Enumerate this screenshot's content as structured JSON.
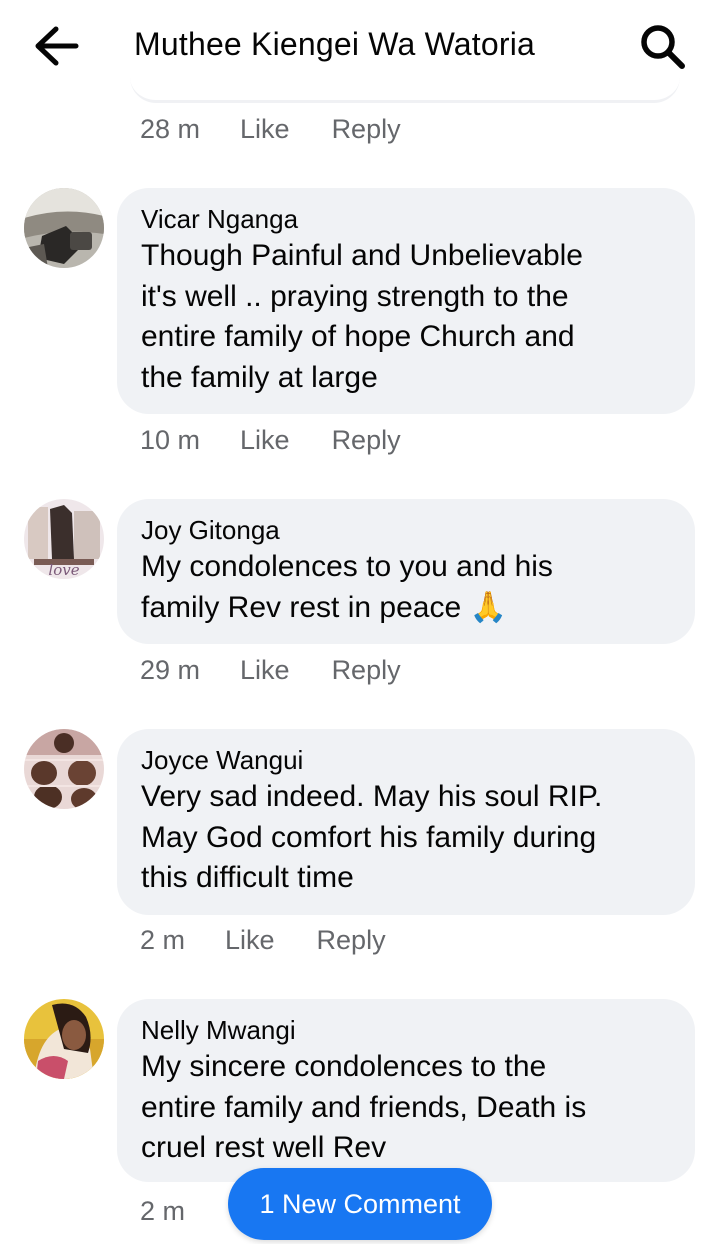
{
  "header": {
    "title": "Muthee Kiengei Wa Watoria",
    "back_icon": "arrow-left-icon",
    "search_icon": "search-icon"
  },
  "previous_comment": {
    "time": "28 m",
    "like": "Like",
    "reply": "Reply"
  },
  "comments": [
    {
      "author": "Vicar Nganga",
      "text_lines": [
        "Though Painful and Unbelievable",
        "it's well .. praying strength to the",
        "entire family of hope Church and",
        "the family at large"
      ],
      "time": "10 m",
      "like": "Like",
      "reply": "Reply"
    },
    {
      "author": "Joy Gitonga",
      "text_lines": [
        "My condolences to you and his",
        "family Rev rest in peace"
      ],
      "emoji": "🙏",
      "avatar_text": "love",
      "time": "29 m",
      "like": "Like",
      "reply": "Reply"
    },
    {
      "author": "Joyce Wangui",
      "text_lines": [
        "Very sad indeed. May his soul RIP.",
        "May God comfort his family during",
        "this difficult time"
      ],
      "time": "2 m",
      "like": "Like",
      "reply": "Reply"
    },
    {
      "author": "Nelly Mwangi",
      "text_lines": [
        "My sincere condolences to the",
        "entire family and friends, Death is",
        "cruel rest well Rev"
      ],
      "time": "2 m"
    }
  ],
  "new_comment_button": {
    "label": "1 New Comment",
    "color": "#1877f2"
  },
  "colors": {
    "bubble": "#f0f2f5",
    "meta_text": "#65676b",
    "accent": "#1877f2"
  }
}
